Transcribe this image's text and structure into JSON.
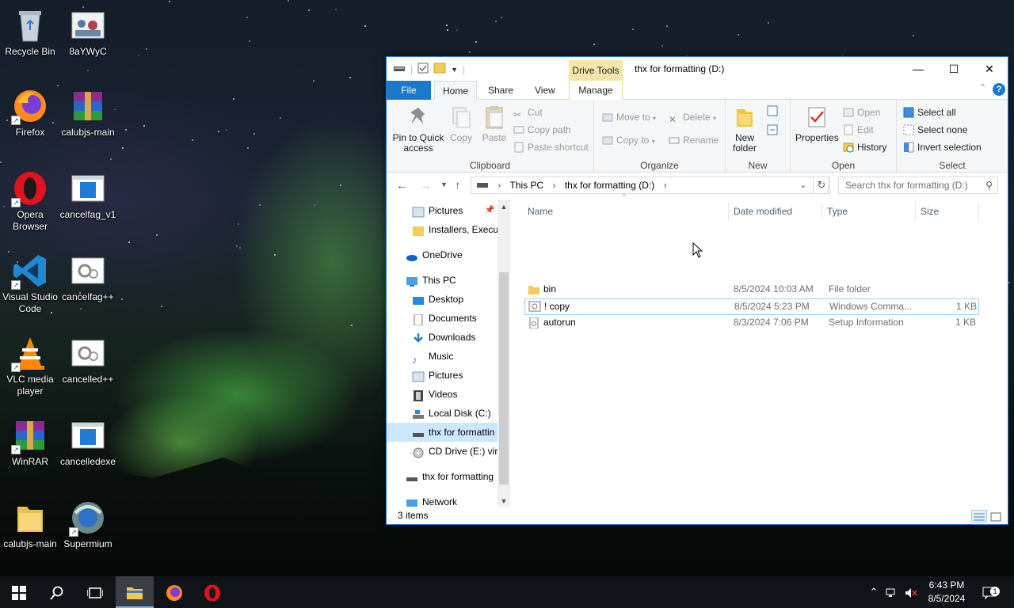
{
  "desktop": {
    "icons": [
      {
        "label": "Recycle Bin"
      },
      {
        "label": "8aYWyC"
      },
      {
        "label": "Firefox"
      },
      {
        "label": "calubjs-main"
      },
      {
        "label": "Opera Browser"
      },
      {
        "label": "cancelfag_v1"
      },
      {
        "label": "Visual Studio Code"
      },
      {
        "label": "cancelfag++"
      },
      {
        "label": "VLC media player"
      },
      {
        "label": "cancelled++"
      },
      {
        "label": "WinRAR"
      },
      {
        "label": "cancelledexe"
      },
      {
        "label": "calubjs-main"
      },
      {
        "label": "Supermium"
      }
    ]
  },
  "explorer": {
    "title": "thx for formatting (D:)",
    "context_tab": "Drive Tools",
    "tabs": {
      "file": "File",
      "home": "Home",
      "share": "Share",
      "view": "View",
      "manage": "Manage"
    },
    "ribbon": {
      "clipboard": {
        "label": "Clipboard",
        "pin": "Pin to Quick access",
        "copy": "Copy",
        "paste": "Paste",
        "cut": "Cut",
        "copy_path": "Copy path",
        "paste_shortcut": "Paste shortcut"
      },
      "organize": {
        "label": "Organize",
        "move_to": "Move to",
        "copy_to": "Copy to",
        "delete": "Delete",
        "rename": "Rename"
      },
      "new": {
        "label": "New",
        "new_folder": "New folder"
      },
      "open": {
        "label": "Open",
        "properties": "Properties",
        "open": "Open",
        "edit": "Edit",
        "history": "History"
      },
      "select": {
        "label": "Select",
        "select_all": "Select all",
        "select_none": "Select none",
        "invert": "Invert selection"
      }
    },
    "address": {
      "crumbs": [
        "This PC",
        "thx for formatting (D:)"
      ],
      "search_placeholder": "Search thx for formatting (D:)"
    },
    "nav": [
      {
        "label": "Pictures",
        "level": 1
      },
      {
        "label": "Installers, Execut",
        "level": 1
      },
      {
        "label": "OneDrive",
        "level": 0
      },
      {
        "label": "This PC",
        "level": 0
      },
      {
        "label": "Desktop",
        "level": 1
      },
      {
        "label": "Documents",
        "level": 1
      },
      {
        "label": "Downloads",
        "level": 1
      },
      {
        "label": "Music",
        "level": 1
      },
      {
        "label": "Pictures",
        "level": 1
      },
      {
        "label": "Videos",
        "level": 1
      },
      {
        "label": "Local Disk (C:)",
        "level": 1
      },
      {
        "label": "thx for formattin",
        "level": 1,
        "selected": true
      },
      {
        "label": "CD Drive (E:) virt",
        "level": 1
      },
      {
        "label": "thx for formatting",
        "level": 0
      },
      {
        "label": "Network",
        "level": 0
      }
    ],
    "columns": {
      "name": "Name",
      "date": "Date modified",
      "type": "Type",
      "size": "Size"
    },
    "files": [
      {
        "name": "bin",
        "date": "8/5/2024 10:03 AM",
        "type": "File folder",
        "size": "",
        "icon": "folder-icon"
      },
      {
        "name": "! copy",
        "date": "8/5/2024 5:23 PM",
        "type": "Windows Comma...",
        "size": "1 KB",
        "icon": "cmd-file-icon"
      },
      {
        "name": "autorun",
        "date": "8/3/2024 7:06 PM",
        "type": "Setup Information",
        "size": "1 KB",
        "icon": "inf-file-icon"
      }
    ],
    "status": "3 items"
  },
  "taskbar": {
    "time": "6:43 PM",
    "date": "8/5/2024",
    "notification_count": "1"
  },
  "colors": {
    "accent": "#1979ca",
    "selection": "#cce8ff",
    "drive_tools": "#f5e6a8"
  }
}
